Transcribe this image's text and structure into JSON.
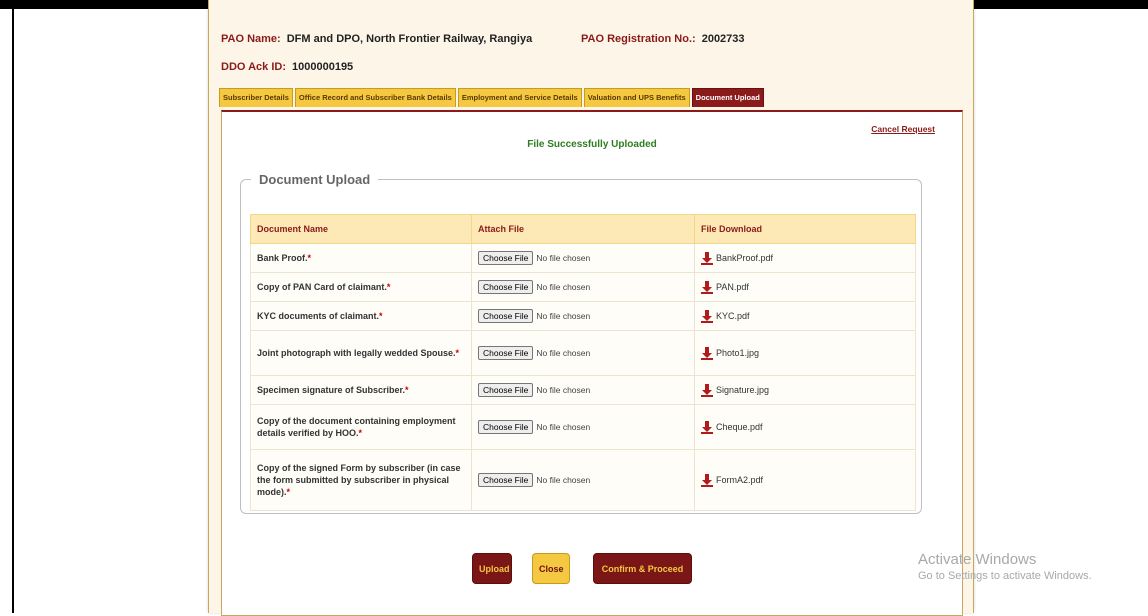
{
  "header": {
    "pao_name_label": "PAO Name:",
    "pao_name_value": "DFM and DPO, North Frontier Railway, Rangiya",
    "pao_reg_label": "PAO Registration No.:",
    "pao_reg_value": "2002733",
    "ddo_label": "DDO Ack ID:",
    "ddo_value": "1000000195"
  },
  "tabs": [
    {
      "label": "Subscriber Details",
      "active": false
    },
    {
      "label": "Office Record and Subscriber Bank Details",
      "active": false
    },
    {
      "label": "Employment and Service Details",
      "active": false
    },
    {
      "label": "Valuation and UPS Benefits",
      "active": false
    },
    {
      "label": "Document Upload",
      "active": true
    }
  ],
  "content": {
    "cancel_link": "Cancel Request",
    "success_message": "File Successfully Uploaded",
    "section_title": "Document Upload",
    "table": {
      "headers": [
        "Document Name",
        "Attach File",
        "File Download"
      ],
      "choose_label": "Choose File",
      "no_file_text": "No file chosen",
      "required_mark": "*",
      "rows": [
        {
          "name": "Bank Proof.",
          "file": "BankProof.pdf"
        },
        {
          "name": "Copy of PAN Card of claimant.",
          "file": "PAN.pdf"
        },
        {
          "name": "KYC documents of claimant.",
          "file": "KYC.pdf"
        },
        {
          "name": "Joint photograph with legally wedded Spouse.",
          "file": "Photo1.jpg"
        },
        {
          "name": "Specimen signature of Subscriber.",
          "file": "Signature.jpg"
        },
        {
          "name": "Copy of the document containing employment details verified by HOO.",
          "file": "Cheque.pdf"
        },
        {
          "name": "Copy of the signed Form by subscriber (in case the form submitted by subscriber in physical mode).",
          "file": "FormA2.pdf"
        }
      ]
    },
    "buttons": {
      "upload": "Upload",
      "close": "Close",
      "confirm": "Confirm & Proceed"
    }
  },
  "watermark": {
    "line1": "Activate Windows",
    "line2": "Go to Settings to activate Windows."
  },
  "colors": {
    "accent": "#8b1a1a",
    "tab_yellow": "#f5c842",
    "success": "#2e7d20",
    "header_row": "#fde9b5"
  },
  "icons": {
    "download": "download-arrow-icon"
  }
}
